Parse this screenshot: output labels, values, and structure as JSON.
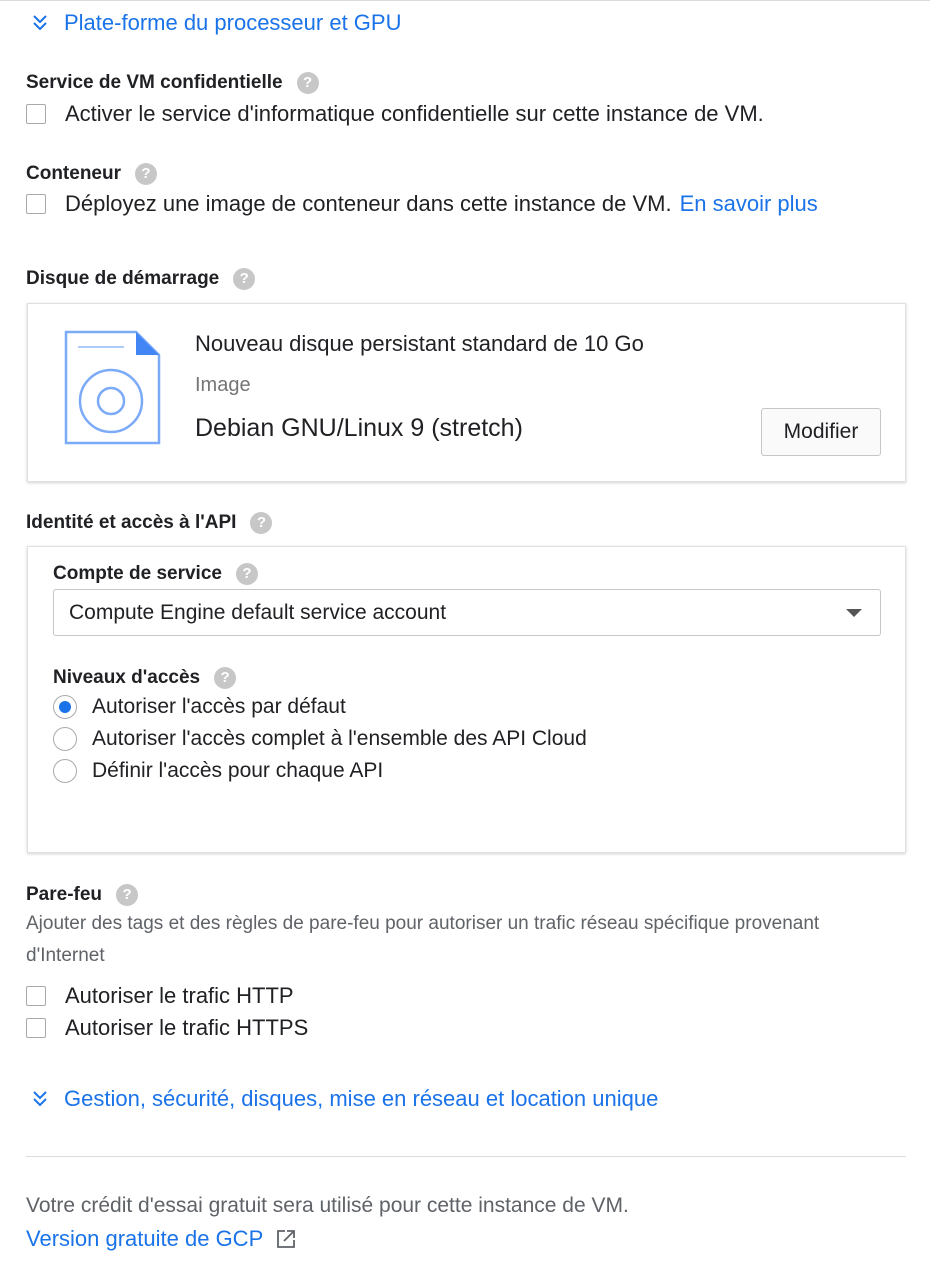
{
  "sections": {
    "platform_link": "Plate-forme du processeur et GPU",
    "confidential": {
      "title": "Service de VM confidentielle",
      "checkbox_label": "Activer le service d'informatique confidentielle sur cette instance de VM.",
      "checked": false
    },
    "container": {
      "title": "Conteneur",
      "checkbox_label": "Déployez une image de conteneur dans cette instance de VM.",
      "learn_more": "En savoir plus",
      "checked": false
    },
    "boot_disk": {
      "title": "Disque de démarrage",
      "disk_name": "Nouveau disque persistant standard de 10 Go",
      "image_label": "Image",
      "os": "Debian GNU/Linux 9 (stretch)",
      "modify_button": "Modifier"
    },
    "identity": {
      "title": "Identité et accès à l'API",
      "service_account_label": "Compte de service",
      "service_account_value": "Compute Engine default service account",
      "access_levels_label": "Niveaux d'accès",
      "options": [
        {
          "label": "Autoriser l'accès par défaut",
          "selected": true
        },
        {
          "label": "Autoriser l'accès complet à l'ensemble des API Cloud",
          "selected": false
        },
        {
          "label": "Définir l'accès pour chaque API",
          "selected": false
        }
      ]
    },
    "firewall": {
      "title": "Pare-feu",
      "description": "Ajouter des tags et des règles de pare-feu pour autoriser un trafic réseau spécifique provenant d'Internet",
      "options": [
        {
          "label": "Autoriser le trafic HTTP",
          "checked": false
        },
        {
          "label": "Autoriser le trafic HTTPS",
          "checked": false
        }
      ]
    },
    "management_link": "Gestion, sécurité, disques, mise en réseau et location unique"
  },
  "footer": {
    "credit_text": "Votre crédit d'essai gratuit sera utilisé pour cette instance de VM.",
    "free_tier_link": "Version gratuite de GCP"
  },
  "icons": {
    "expand": "chevron-double-down-icon",
    "help": "help-circle-icon",
    "disk": "disk-image-icon",
    "external": "external-link-icon",
    "dropdown": "caret-down-icon"
  },
  "colors": {
    "accent": "#1a73e8",
    "text": "#202124",
    "muted": "#5f6368",
    "help_icon": "#c7c7c7"
  }
}
